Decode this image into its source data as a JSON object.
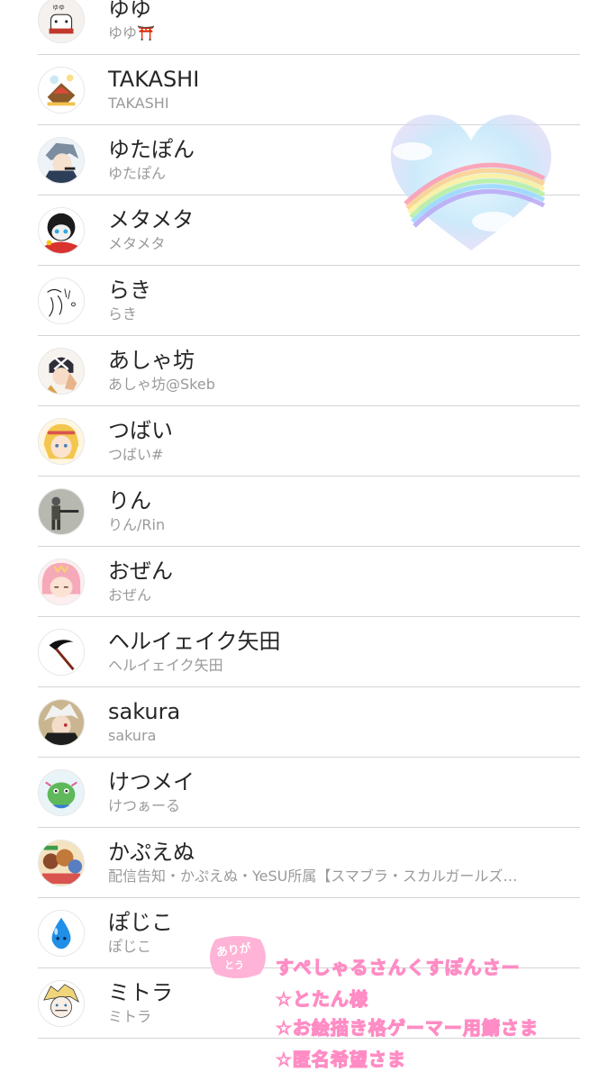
{
  "following_list": [
    {
      "name": "ゆゆ",
      "handle": "ゆゆ⛩️",
      "avatar_icon": "bear-mascot-avatar"
    },
    {
      "name": "TAKASHI",
      "handle": "TAKASHI",
      "avatar_icon": "dragon-illustration-avatar"
    },
    {
      "name": "ゆたぽん",
      "handle": "ゆたぽん",
      "avatar_icon": "grey-hair-character-avatar"
    },
    {
      "name": "メタメタ",
      "handle": "メタメタ",
      "avatar_icon": "masked-character-avatar"
    },
    {
      "name": "らき",
      "handle": "らき",
      "avatar_icon": "sketch-doodle-avatar"
    },
    {
      "name": "あしゃ坊",
      "handle": "あしゃ坊@Skeb",
      "avatar_icon": "peace-sign-character-avatar"
    },
    {
      "name": "つばい",
      "handle": "つばい#",
      "avatar_icon": "blonde-girl-avatar"
    },
    {
      "name": "りん",
      "handle": "りん/Rin",
      "avatar_icon": "soldier-character-avatar"
    },
    {
      "name": "おぜん",
      "handle": "おぜん",
      "avatar_icon": "pink-hair-character-avatar"
    },
    {
      "name": "ヘルイェイク矢田",
      "handle": "ヘルイェイク矢田",
      "avatar_icon": "scythe-avatar"
    },
    {
      "name": "sakura",
      "handle": "sakura",
      "avatar_icon": "white-hair-character-avatar"
    },
    {
      "name": "けつメイ",
      "handle": "けつぁーる",
      "avatar_icon": "green-creature-avatar"
    },
    {
      "name": "かぷえぬ",
      "handle": "配信告知・かぷえぬ・YeSU所属【スマブラ・スカルガールズ…",
      "avatar_icon": "group-characters-avatar"
    },
    {
      "name": "ぽじこ",
      "handle": "ぽじこ",
      "avatar_icon": "water-drop-avatar"
    },
    {
      "name": "ミトラ",
      "handle": "ミトラ",
      "avatar_icon": "blonde-boy-sketch-avatar"
    }
  ],
  "overlay": {
    "heart_sticker": "rainbow-heart-sticker",
    "thanks_badge_line1": "ありが",
    "thanks_badge_line2": "とう",
    "sponsor_lines": [
      "すぺしゃるさんくすぽんさー",
      "☆とたん様",
      "☆お絵描き格ゲーマー用鯖さま",
      "☆匿名希望さま"
    ]
  },
  "colors": {
    "divider": "#d4d4d4",
    "name_text": "#262626",
    "handle_text": "#9a9a9a",
    "sponsor_fill": "#ffd3e9",
    "sponsor_stroke": "#ff8cc4",
    "badge_pink": "#ffb3d6"
  }
}
